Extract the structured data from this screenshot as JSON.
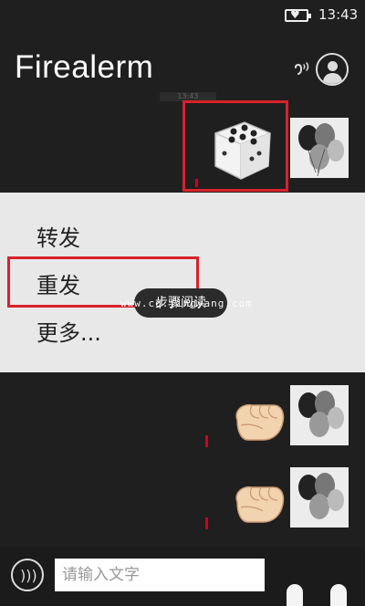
{
  "status_bar": {
    "time": "13:43",
    "battery_icon": "battery-heart-icon"
  },
  "header": {
    "title": "Firealerm",
    "voice_icon": "hearing-icon",
    "profile_icon": "person-icon"
  },
  "timestamp_hint": "13:43",
  "messages": [
    {
      "type": "image",
      "content": "dice-image",
      "status": "failed"
    },
    {
      "type": "emoji",
      "content": "fist-emoji",
      "status": "failed"
    },
    {
      "type": "emoji",
      "content": "fist-emoji",
      "status": "failed"
    }
  ],
  "context_menu": {
    "items": [
      {
        "label": "转发"
      },
      {
        "label": "重发"
      },
      {
        "label": "更多..."
      }
    ]
  },
  "toast": {
    "text": "步骤阅读"
  },
  "watermark": "www.cq.jingyang.com",
  "input": {
    "placeholder": "请输入文字",
    "voice_icon": "voice-wave-icon"
  },
  "colors": {
    "highlight": "#d7222a",
    "error": "#d0021b",
    "background": "#1f1f1f",
    "menu": "#e8e8e8"
  }
}
